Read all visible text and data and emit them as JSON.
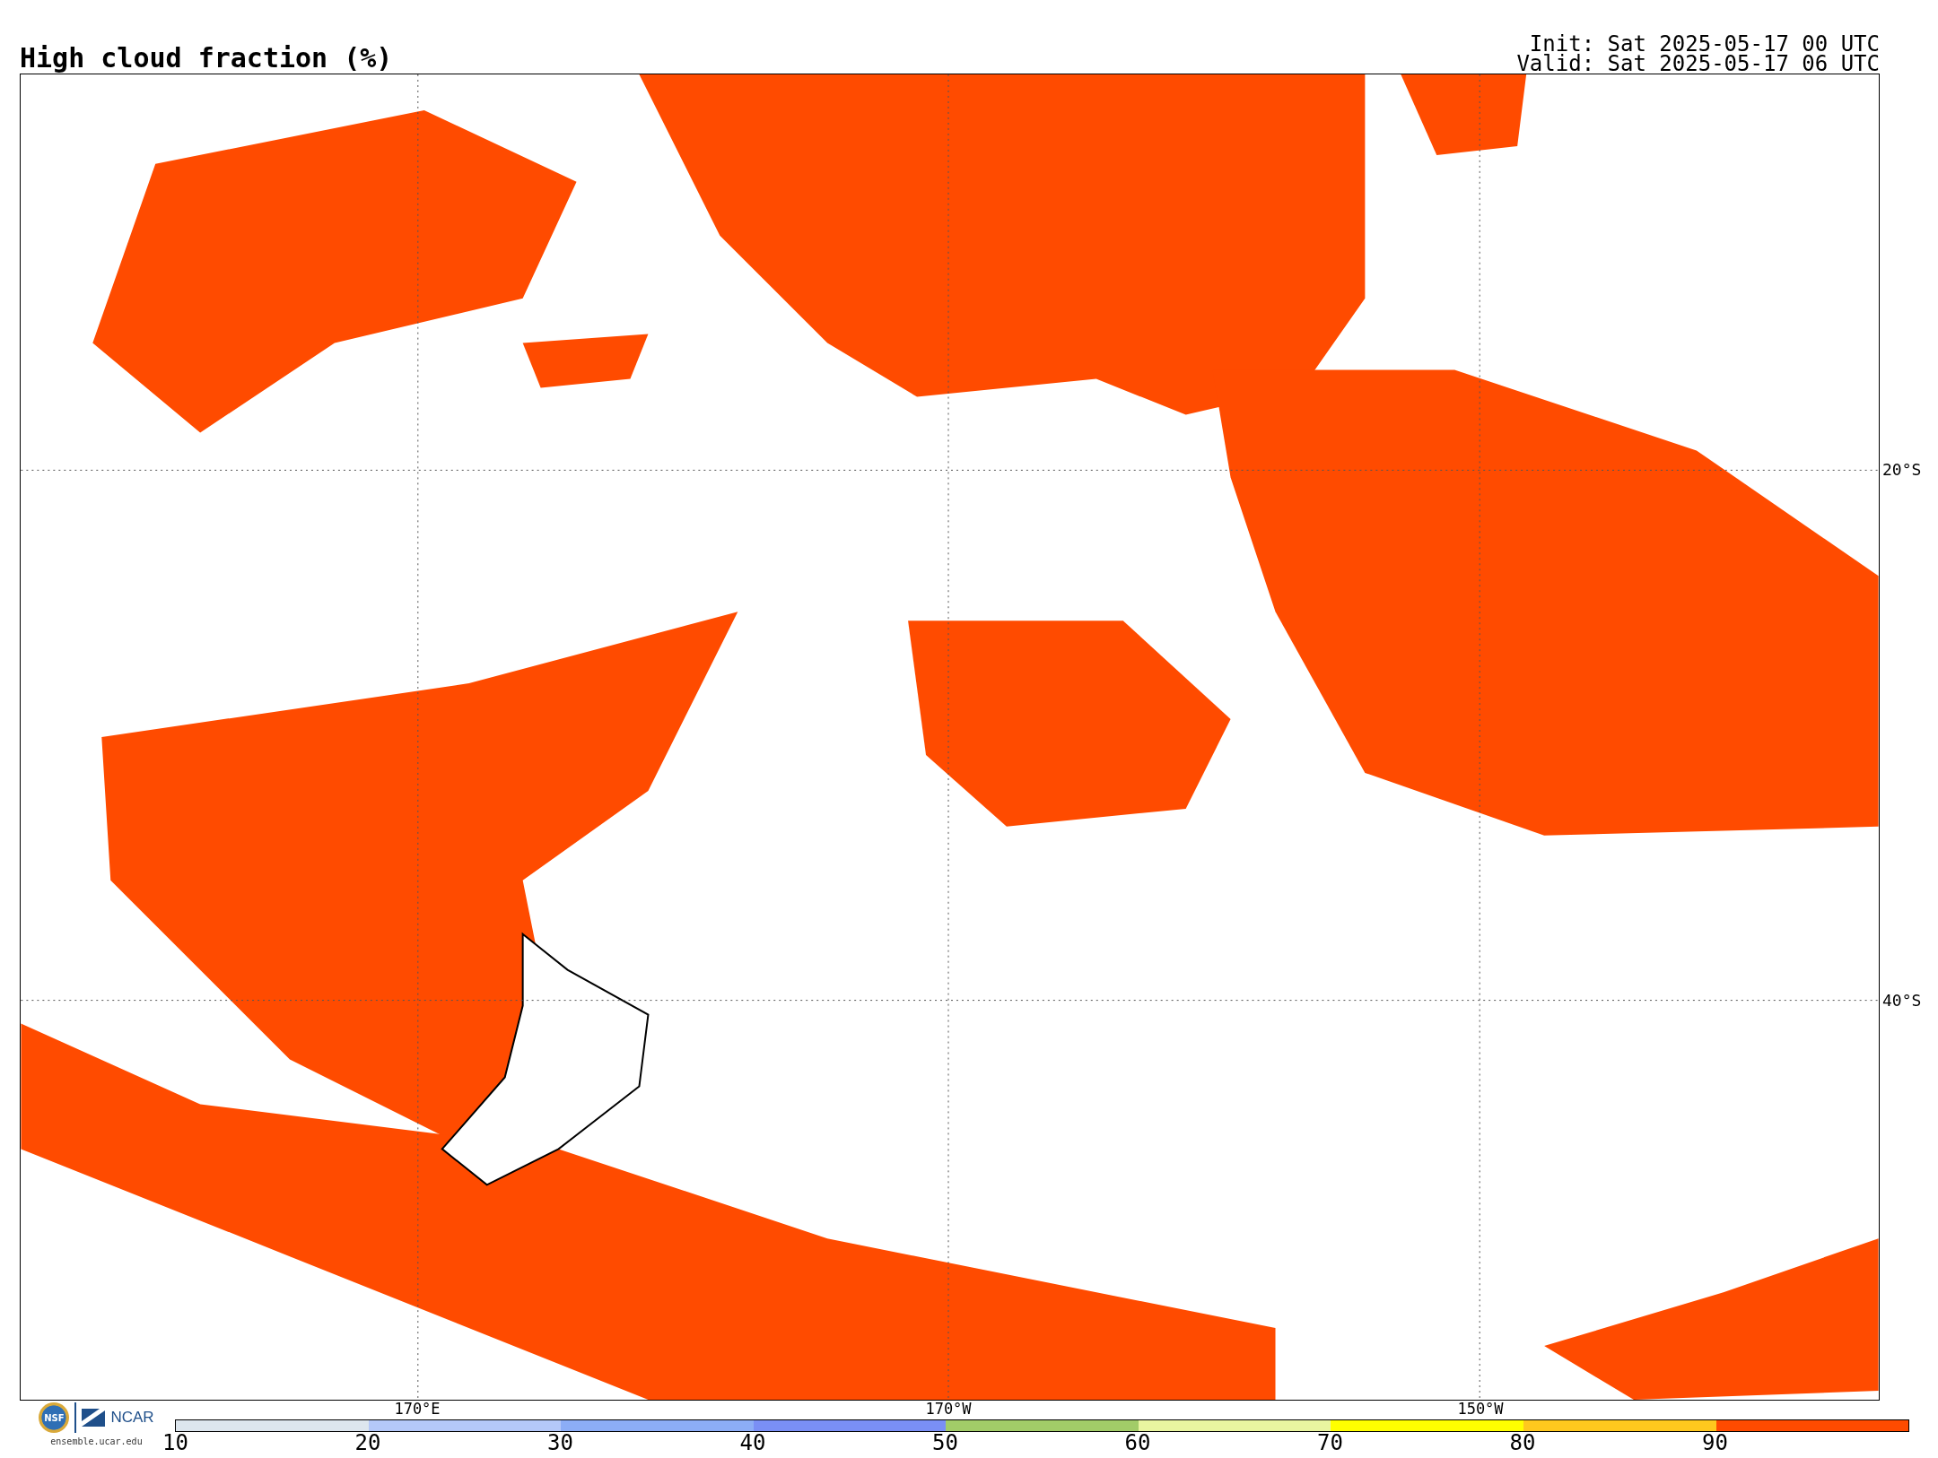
{
  "header": {
    "title": "High cloud fraction (%)",
    "init": "Init: Sat 2025-05-17 00 UTC",
    "valid": "Valid: Sat 2025-05-17 06 UTC"
  },
  "lat_labels": [
    "20°S",
    "40°S"
  ],
  "lon_labels": [
    "170°E",
    "170°W",
    "150°W"
  ],
  "logo": {
    "seal": "NSF",
    "org": "NCAR",
    "site": "ensemble.ucar.edu"
  },
  "colorbar": {
    "segments": [
      {
        "color": "#dde6ee"
      },
      {
        "color": "#b4c8f8"
      },
      {
        "color": "#8cadf6"
      },
      {
        "color": "#7a8ff5"
      },
      {
        "color": "#a2cc68"
      },
      {
        "color": "#e9f5a0"
      },
      {
        "color": "#ffff00"
      },
      {
        "color": "#ffc81e"
      },
      {
        "color": "#ff4b00"
      }
    ],
    "ticks": [
      "10",
      "20",
      "30",
      "40",
      "50",
      "60",
      "70",
      "80",
      "90"
    ]
  }
}
